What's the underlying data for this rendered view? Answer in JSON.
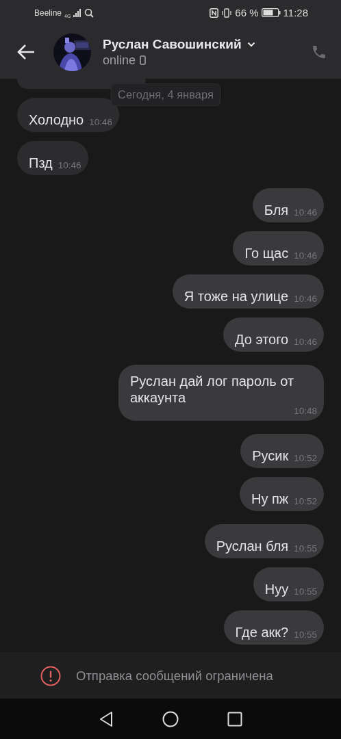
{
  "status_bar": {
    "carrier": "Beeline",
    "network": "4G",
    "battery": "66 %",
    "time": "11:28"
  },
  "header": {
    "name": "Руслан Савошинский",
    "status": "online"
  },
  "date_separator": "Сегодня, 4 января",
  "messages": [
    {
      "kind": "incoming",
      "text": "Холодно",
      "time": "10:46"
    },
    {
      "kind": "incoming",
      "text": "Пзд",
      "time": "10:46"
    },
    {
      "kind": "outgoing",
      "text": "Бля",
      "time": "10:46"
    },
    {
      "kind": "outgoing",
      "text": "Го щас",
      "time": "10:46"
    },
    {
      "kind": "outgoing",
      "text": "Я тоже на улице",
      "time": "10:46"
    },
    {
      "kind": "outgoing",
      "text": "До этого",
      "time": "10:46"
    },
    {
      "kind": "outgoing",
      "text": "Руслан дай лог пароль от аккаунта",
      "time": "10:48"
    },
    {
      "kind": "outgoing",
      "text": "Русик",
      "time": "10:52"
    },
    {
      "kind": "outgoing",
      "text": "Ну пж",
      "time": "10:52"
    },
    {
      "kind": "outgoing",
      "text": "Руслан бля",
      "time": "10:55"
    },
    {
      "kind": "outgoing",
      "text": "Нуу",
      "time": "10:55"
    },
    {
      "kind": "outgoing",
      "text": "Где акк?",
      "time": "10:55"
    }
  ],
  "restriction_notice": "Отправка сообщений ограничена"
}
